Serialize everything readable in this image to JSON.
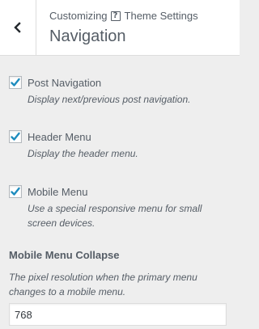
{
  "header": {
    "breadcrumb_prefix": "Customizing",
    "help_icon": "help-icon",
    "breadcrumb_section": "Theme Settings",
    "title": "Navigation",
    "back_icon": "chevron-left-icon"
  },
  "controls": [
    {
      "label": "Post Navigation",
      "description": "Display next/previous post navigation.",
      "checked": true
    },
    {
      "label": "Header Menu",
      "description": "Display the header menu.",
      "checked": true
    },
    {
      "label": "Mobile Menu",
      "description": "Use a special responsive menu for small screen devices.",
      "checked": true
    }
  ],
  "mobile_collapse": {
    "title": "Mobile Menu Collapse",
    "description": "The pixel resolution when the primary menu changes to a mobile menu.",
    "value": "768"
  },
  "colors": {
    "check": "#1e8cbe",
    "text": "#555d66",
    "background": "#eeeeee"
  }
}
